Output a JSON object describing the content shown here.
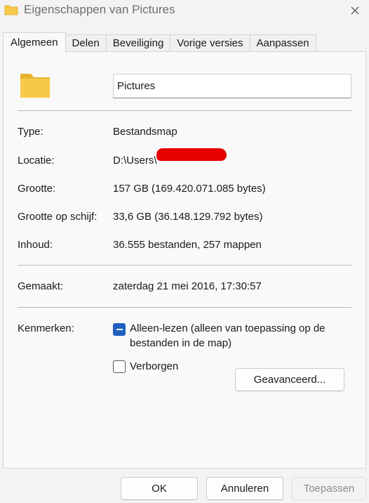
{
  "window": {
    "title": "Eigenschappen van Pictures"
  },
  "tabs": [
    {
      "label": "Algemeen",
      "active": true
    },
    {
      "label": "Delen"
    },
    {
      "label": "Beveiliging"
    },
    {
      "label": "Vorige versies"
    },
    {
      "label": "Aanpassen"
    }
  ],
  "general": {
    "folder_name": "Pictures",
    "type_label": "Type:",
    "type_value": "Bestandsmap",
    "location_label": "Locatie:",
    "location_value": "D:\\Users\\",
    "size_label": "Grootte:",
    "size_value": "157 GB (169.420.071.085 bytes)",
    "disk_size_label": "Grootte op schijf:",
    "disk_size_value": "33,6 GB (36.148.129.792 bytes)",
    "contents_label": "Inhoud:",
    "contents_value": "36.555 bestanden, 257 mappen",
    "created_label": "Gemaakt:",
    "created_value": "zaterdag 21 mei 2016, 17:30:57",
    "attributes_label": "Kenmerken:",
    "readonly_label": "Alleen-lezen (alleen van toepassing op de bestanden in de map)",
    "readonly_state": "indeterminate",
    "hidden_label": "Verborgen",
    "hidden_state": "unchecked",
    "advanced_label": "Geavanceerd..."
  },
  "footer": {
    "ok_label": "OK",
    "cancel_label": "Annuleren",
    "apply_label": "Toepassen"
  },
  "colors": {
    "folder": "#f7c948",
    "checkbox_accent": "#1f5fbf",
    "redaction": "#e60000"
  }
}
